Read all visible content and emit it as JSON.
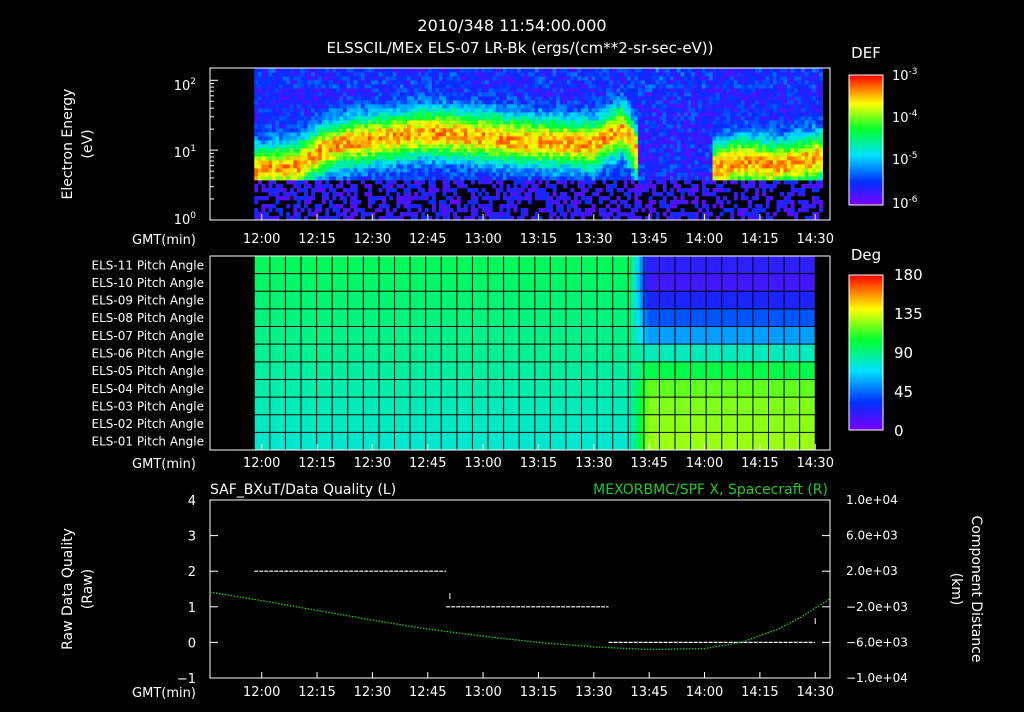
{
  "title_line1": "2010/348 11:54:00.000",
  "title_line2": "ELSSCIL/MEx ELS-07 LR-Bk  (ergs/(cm**2-sr-sec-eV))",
  "colors": {
    "background": "#000000",
    "foreground": "#ffffff",
    "green_series": "#22cc22"
  },
  "chart_data": [
    {
      "type": "heatmap",
      "name": "energy-spectrogram",
      "ylabel_line1": "Electron Energy",
      "ylabel_line2": "(eV)",
      "xlabel": "GMT(min)",
      "x_tick_labels": [
        "12:00",
        "12:15",
        "12:30",
        "12:45",
        "13:00",
        "13:15",
        "13:30",
        "13:45",
        "14:00",
        "14:15",
        "14:30"
      ],
      "y_scale": "log",
      "ylim": [
        1,
        150
      ],
      "y_ticks": [
        {
          "base": "10",
          "exp": "0"
        },
        {
          "base": "10",
          "exp": "1"
        },
        {
          "base": "10",
          "exp": "2"
        }
      ],
      "colorbar": {
        "label": "DEF",
        "scale": "log",
        "range": [
          1e-06,
          0.001
        ],
        "ticks": [
          {
            "base": "10",
            "exp": "-3"
          },
          {
            "base": "10",
            "exp": "-4"
          },
          {
            "base": "10",
            "exp": "-5"
          },
          {
            "base": "10",
            "exp": "-6"
          }
        ]
      },
      "x_range_minutes": [
        706,
        874
      ],
      "data_start_minutes": 718,
      "data_end_minutes": 872,
      "peak_energy_profile": [
        {
          "t": 718,
          "e": 5
        },
        {
          "t": 730,
          "e": 6
        },
        {
          "t": 740,
          "e": 12
        },
        {
          "t": 765,
          "e": 18
        },
        {
          "t": 790,
          "e": 14
        },
        {
          "t": 810,
          "e": 12
        },
        {
          "t": 818,
          "e": 20
        },
        {
          "t": 822,
          "e": 8
        },
        {
          "t": 835,
          "e": 4
        },
        {
          "t": 850,
          "e": 7
        },
        {
          "t": 860,
          "e": 6
        },
        {
          "t": 872,
          "e": 8
        }
      ]
    },
    {
      "type": "heatmap",
      "name": "pitch-angle-grid",
      "xlabel": "GMT(min)",
      "x_tick_labels": [
        "12:00",
        "12:15",
        "12:30",
        "12:45",
        "13:00",
        "13:15",
        "13:30",
        "13:45",
        "14:00",
        "14:15",
        "14:30"
      ],
      "rows": [
        "ELS-11 Pitch Angle",
        "ELS-10 Pitch Angle",
        "ELS-09 Pitch Angle",
        "ELS-08 Pitch Angle",
        "ELS-07 Pitch Angle",
        "ELS-06 Pitch Angle",
        "ELS-05 Pitch Angle",
        "ELS-04 Pitch Angle",
        "ELS-03 Pitch Angle",
        "ELS-02 Pitch Angle",
        "ELS-01 Pitch Angle"
      ],
      "colorbar": {
        "label": "Deg",
        "range": [
          0,
          180
        ],
        "ticks": [
          "180",
          "135",
          "90",
          "45",
          "0"
        ]
      },
      "x_range_minutes": [
        706,
        874
      ],
      "data_start_minutes": 718,
      "data_end_minutes": 870,
      "transition_minutes": 820,
      "pitch_before_deg": [
        97,
        95,
        93,
        91,
        89,
        87,
        85,
        83,
        81,
        79,
        77
      ],
      "pitch_after_deg": [
        20,
        15,
        25,
        40,
        55,
        80,
        100,
        118,
        122,
        124,
        126
      ]
    },
    {
      "type": "line",
      "name": "data-quality-and-distance",
      "left_title": "SAF_BXuT/Data Quality (L)",
      "right_title": "MEXORBMC/SPF X, Spacecraft (R)",
      "ylabel_line1": "Raw Data Quality",
      "ylabel_line2": "(Raw)",
      "y2label_line1": "Component Distance",
      "y2label_line2": "(km)",
      "xlabel": "GMT(min)",
      "x_tick_labels": [
        "12:00",
        "12:15",
        "12:30",
        "12:45",
        "13:00",
        "13:15",
        "13:30",
        "13:45",
        "14:00",
        "14:15",
        "14:30"
      ],
      "x_range_minutes": [
        706,
        874
      ],
      "ylim": [
        -1,
        4
      ],
      "y_tick_labels": [
        "4",
        "3",
        "2",
        "1",
        "0",
        "−1"
      ],
      "y2lim": [
        -10000,
        10000
      ],
      "y2_tick_labels": [
        "1.0e+04",
        "6.0e+03",
        "2.0e+03",
        "−2.0e+03",
        "−6.0e+03",
        "−1.0e+04"
      ],
      "series": [
        {
          "axis": "left",
          "color": "#ffffff",
          "segments": [
            {
              "x": [
                718,
                770
              ],
              "y": 2
            },
            {
              "x": [
                770,
                814
              ],
              "y": 1
            },
            {
              "x": [
                814,
                870
              ],
              "y": 0
            }
          ],
          "marks": [
            {
              "x": 771,
              "y": 1.3
            },
            {
              "x": 870,
              "y": 0.6
            }
          ]
        },
        {
          "axis": "right",
          "color": "#22cc22",
          "x": [
            706,
            720,
            735,
            750,
            765,
            780,
            795,
            810,
            825,
            840,
            850,
            860,
            866,
            874
          ],
          "values": [
            -350,
            -1300,
            -2400,
            -3500,
            -4500,
            -5300,
            -6000,
            -6500,
            -6800,
            -6700,
            -6000,
            -4500,
            -3200,
            -1100
          ]
        }
      ]
    }
  ]
}
